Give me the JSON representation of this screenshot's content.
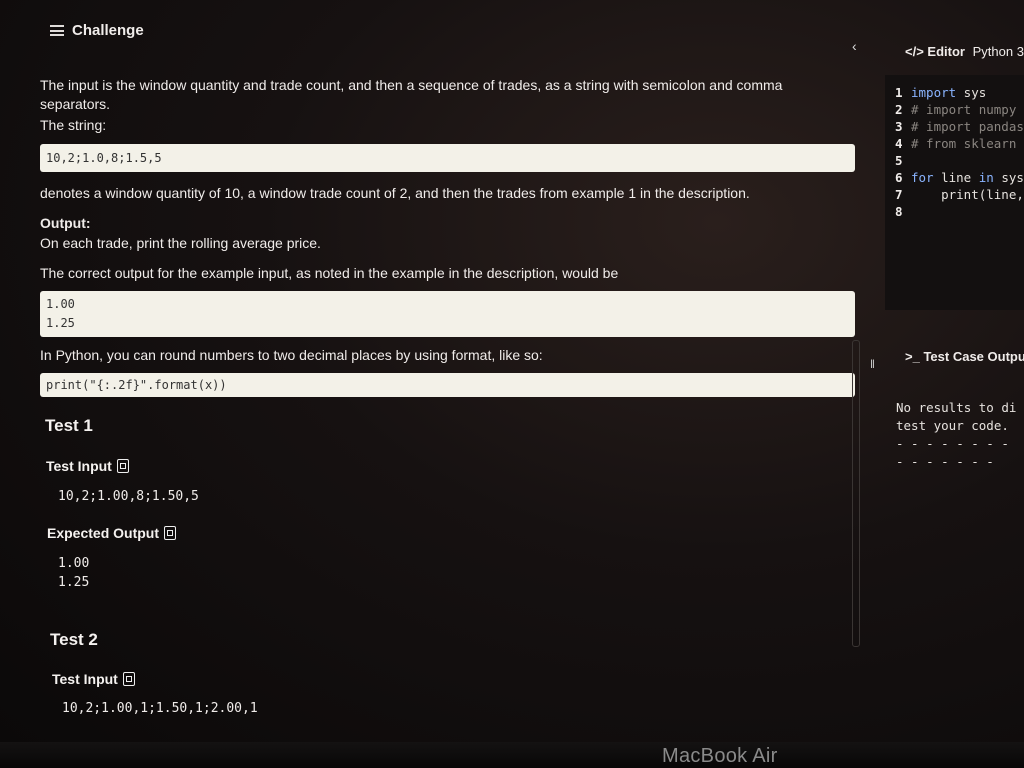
{
  "challenge": {
    "header_label": "Challenge",
    "intro": "The input is the window quantity and trade count, and then a sequence of trades, as a string with semicolon and comma separators.",
    "string_label": "The string:",
    "string_example": "10,2;1.0,8;1.5,5",
    "denotes_text": "denotes a window quantity of 10, a window trade count of 2, and then the trades from example 1 in the description.",
    "output_label": "Output:",
    "output_desc": "On each trade, print the rolling average price.",
    "correct_output_text": "The correct output for the example input, as noted in the example in the description, would be",
    "example_output_lines": [
      "1.00",
      "1.25"
    ],
    "python_tip": "In Python, you can round numbers to two decimal places by using format, like so:",
    "python_code": "print(\"{:.2f}\".format(x))"
  },
  "tests": [
    {
      "title": "Test 1",
      "input_label": "Test Input",
      "input_value": "10,2;1.00,8;1.50,5",
      "expected_label": "Expected Output",
      "expected_lines": [
        "1.00",
        "1.25"
      ]
    },
    {
      "title": "Test 2",
      "input_label": "Test Input",
      "input_value": "10,2;1.00,1;1.50,1;2.00,1"
    }
  ],
  "editor": {
    "title": "Editor",
    "language": "Python 3",
    "lines": [
      {
        "num": "1",
        "parts": [
          {
            "cls": "kw",
            "text": "import"
          },
          {
            "cls": "tx",
            "text": " sys"
          }
        ]
      },
      {
        "num": "2",
        "parts": [
          {
            "cls": "cm",
            "text": "# import numpy"
          }
        ]
      },
      {
        "num": "3",
        "parts": [
          {
            "cls": "cm",
            "text": "# import pandas"
          }
        ]
      },
      {
        "num": "4",
        "parts": [
          {
            "cls": "cm",
            "text": "# from sklearn"
          }
        ]
      },
      {
        "num": "5",
        "parts": []
      },
      {
        "num": "6",
        "parts": [
          {
            "cls": "kw",
            "text": "for"
          },
          {
            "cls": "tx",
            "text": " line "
          },
          {
            "cls": "kw",
            "text": "in"
          },
          {
            "cls": "tx",
            "text": " sys"
          }
        ]
      },
      {
        "num": "7",
        "parts": [
          {
            "cls": "tx",
            "text": "    print(line,"
          }
        ]
      },
      {
        "num": "8",
        "parts": []
      }
    ]
  },
  "test_output": {
    "title": "Test Case Output",
    "text": "No results to di\ntest your code.\n- - - - - - - -\n- - - - - - -"
  },
  "device_label": "MacBook Air"
}
